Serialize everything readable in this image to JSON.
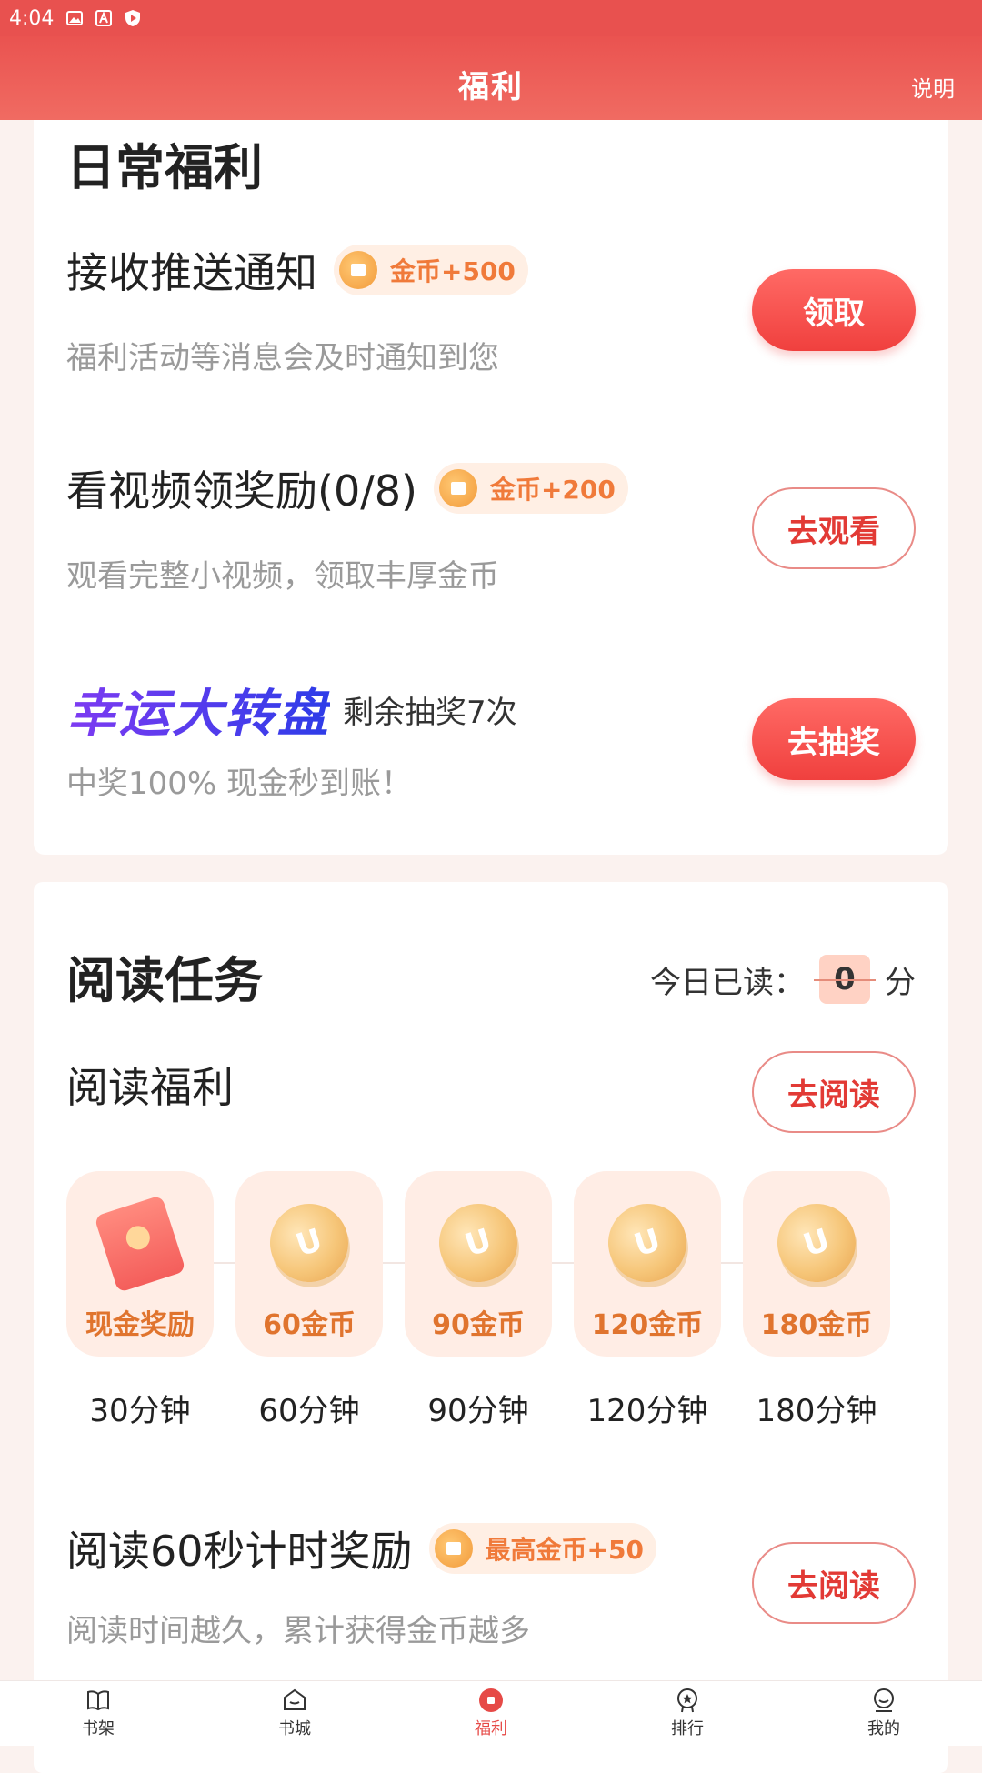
{
  "status_bar": {
    "time": "4:04",
    "icons": [
      "image-icon",
      "a-letter-icon",
      "shield-play-icon"
    ]
  },
  "header": {
    "title": "福利",
    "help": "说明"
  },
  "daily": {
    "title": "日常福利",
    "tasks": [
      {
        "title": "接收推送通知",
        "badge": "金币+500",
        "desc": "福利活动等消息会及时通知到您",
        "button": "领取"
      },
      {
        "title": "看视频领奖励(0/8)",
        "badge": "金币+200",
        "desc": "观看完整小视频，领取丰厚金币",
        "button": "去观看"
      }
    ],
    "lucky": {
      "logo": "幸运大转盘",
      "remain": "剩余抽奖7次",
      "desc": "中奖100% 现金秒到账！",
      "button": "去抽奖"
    }
  },
  "reading": {
    "title": "阅读任务",
    "today_label": "今日已读：",
    "today_value": "0",
    "today_unit": "分",
    "welfare_title": "阅读福利",
    "welfare_button": "去阅读",
    "rewards": [
      {
        "label": "现金奖励",
        "time": "30分钟",
        "icon": "red-packet-icon"
      },
      {
        "label": "60金币",
        "time": "60分钟",
        "icon": "coin-icon"
      },
      {
        "label": "90金币",
        "time": "90分钟",
        "icon": "coin-icon"
      },
      {
        "label": "120金币",
        "time": "120分钟",
        "icon": "coin-icon"
      },
      {
        "label": "180金币",
        "time": "180分钟",
        "icon": "coin-icon"
      }
    ],
    "timer_task": {
      "title": "阅读60秒计时奖励",
      "badge": "最高金币+50",
      "desc": "阅读时间越久，累计获得金币越多",
      "button": "去阅读"
    }
  },
  "bottom_nav": [
    {
      "label": "书架",
      "icon": "book-icon"
    },
    {
      "label": "书城",
      "icon": "store-icon"
    },
    {
      "label": "福利",
      "icon": "welfare-icon",
      "active": true
    },
    {
      "label": "排行",
      "icon": "rank-icon"
    },
    {
      "label": "我的",
      "icon": "profile-icon"
    }
  ],
  "colors": {
    "accent": "#E8514F",
    "coin_text": "#F07A3A",
    "reward_bg": "#FFEDE5"
  }
}
